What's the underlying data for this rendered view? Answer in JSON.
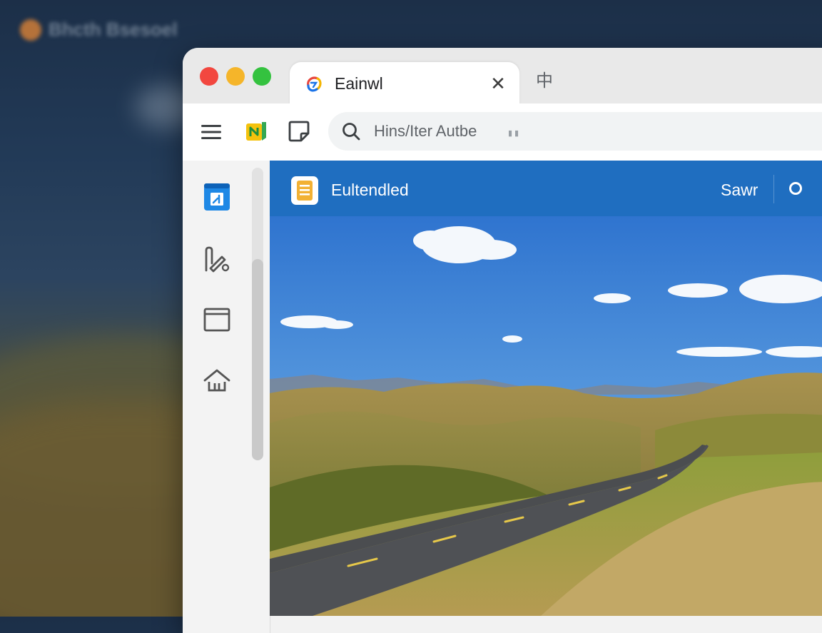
{
  "desktop": {
    "blurred_title": "Bhcth Bsesoel"
  },
  "browser": {
    "tab": {
      "title": "Eainwl",
      "close_glyph": "✕"
    },
    "new_tab_glyph": "中",
    "toolbar": {
      "address_text": "Hins/Iter Autbe"
    }
  },
  "app": {
    "title": "Eultendled",
    "save_label": "Sawr"
  },
  "colors": {
    "appbar": "#1f6ec0",
    "traffic_close": "#f2473f",
    "traffic_min": "#f5b52a",
    "traffic_max": "#34c23f"
  },
  "icons": {
    "sidebar": [
      "bookmark-app-icon",
      "edit-tool-icon",
      "window-icon",
      "home-icon"
    ],
    "toolbar": [
      "menu-icon",
      "extension-icon",
      "reader-icon",
      "search-icon"
    ]
  }
}
